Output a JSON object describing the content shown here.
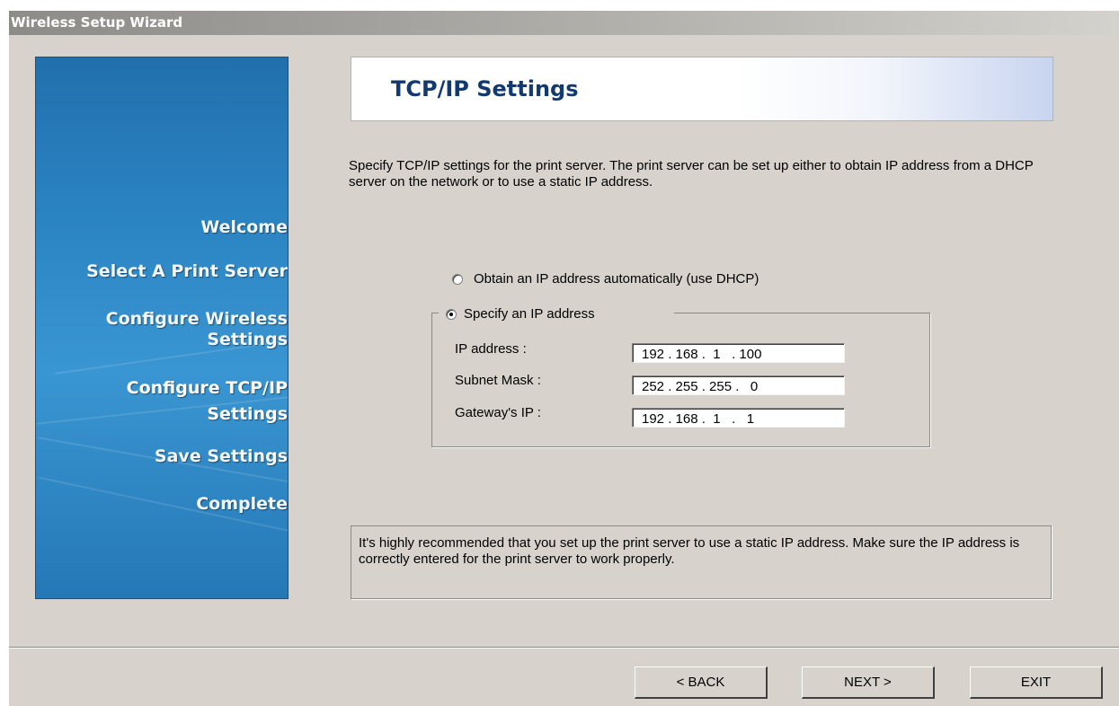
{
  "window": {
    "title": "Wireless Setup Wizard"
  },
  "sidebar": {
    "steps": [
      {
        "label": "Welcome"
      },
      {
        "label": "Select A Print Server"
      },
      {
        "label_line1": "Configure Wireless",
        "label_line2": "Settings"
      },
      {
        "label_line1": "Configure TCP/IP",
        "label_line2": "Settings",
        "active": true
      },
      {
        "label": "Save Settings"
      },
      {
        "label": "Complete"
      }
    ]
  },
  "header": {
    "title": "TCP/IP Settings"
  },
  "description": "Specify TCP/IP settings for the print server. The print server can be set up either to obtain IP address from a DHCP server on the network or to use a static IP address.",
  "options": {
    "dhcp": {
      "label": "Obtain an IP address automatically (use DHCP)",
      "checked": false
    },
    "static": {
      "label": "Specify an IP address",
      "checked": true
    }
  },
  "static_ip": {
    "ip_address": {
      "label": "IP address :",
      "value": "192 . 168 .  1   . 100"
    },
    "subnet_mask": {
      "label": "Subnet Mask :",
      "value": "252 . 255 . 255 .   0"
    },
    "gateway": {
      "label": "Gateway's IP :",
      "value": "192 . 168 .  1   .   1"
    }
  },
  "note": "It's highly recommended that you set up the print server to use a static IP address. Make sure the IP address is correctly entered for the print server to work properly.",
  "buttons": {
    "back": "< BACK",
    "next": "NEXT >",
    "exit": "EXIT"
  }
}
